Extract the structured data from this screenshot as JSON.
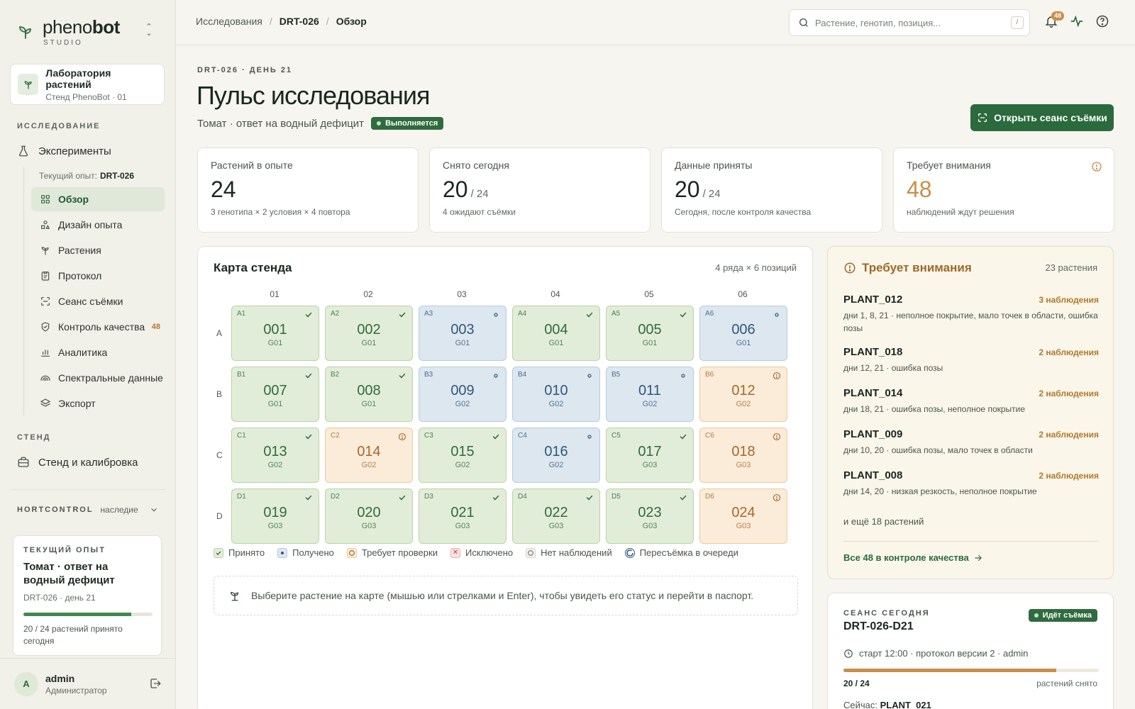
{
  "brand": {
    "name_light": "pheno",
    "name_bold": "bot",
    "sub": "STUDIO"
  },
  "lab": {
    "title": "Лаборатория растений",
    "subtitle": "Стенд PhenoBot · 01"
  },
  "sidebar": {
    "section_research": "ИССЛЕДОВАНИЕ",
    "experiments": "Эксперименты",
    "current_exp_label": "Текущий опыт:",
    "current_exp_id": "DRT-026",
    "items": [
      {
        "label": "Обзор",
        "icon": "grid-icon",
        "active": true
      },
      {
        "label": "Дизайн опыта",
        "icon": "shapes-icon"
      },
      {
        "label": "Растения",
        "icon": "sprout-icon"
      },
      {
        "label": "Протокол",
        "icon": "clipboard-icon"
      },
      {
        "label": "Сеанс съёмки",
        "icon": "scan-icon"
      },
      {
        "label": "Контроль качества",
        "icon": "shield-check-icon",
        "badge": "48"
      },
      {
        "label": "Аналитика",
        "icon": "bar-chart-icon"
      },
      {
        "label": "Спектральные данные",
        "icon": "rainbow-icon"
      },
      {
        "label": "Экспорт",
        "icon": "layers-icon"
      }
    ],
    "section_bench": "СТЕНД",
    "bench": "Стенд и калибровка",
    "legacy_key": "HORTCONTROL",
    "legacy_val": "наследие"
  },
  "current_card": {
    "label": "ТЕКУЩИЙ ОПЫТ",
    "title": "Томат · ответ на водный дефицит",
    "sub": "DRT-026 · день 21",
    "progress": 0.833,
    "foot": "20 / 24 растений принято сегодня"
  },
  "user": {
    "initial": "A",
    "name": "admin",
    "role": "Администратор"
  },
  "breadcrumbs": {
    "root": "Исследования",
    "mid": "DRT-026",
    "current": "Обзор"
  },
  "search": {
    "placeholder": "Растение, генотип, позиция...",
    "shortcut": "/"
  },
  "notifications": {
    "count": "48"
  },
  "header": {
    "eyebrow": "DRT-026 · ДЕНЬ 21",
    "title": "Пульс исследования",
    "subtitle": "Томат · ответ на водный дефицит",
    "status": "Выполняется",
    "action": "Открыть сеанс съёмки"
  },
  "kpis": [
    {
      "label": "Растений в опыте",
      "value": "24",
      "total": "",
      "foot": "3 генотипа × 2 условия × 4 повтора"
    },
    {
      "label": "Снято сегодня",
      "value": "20",
      "total": "/ 24",
      "foot": "4 ожидают съёмки"
    },
    {
      "label": "Данные приняты",
      "value": "20",
      "total": "/ 24",
      "foot": "Сегодня, после контроля качества"
    },
    {
      "label": "Требует внимания",
      "value": "48",
      "total": "",
      "foot": "наблюдений ждут решения"
    }
  ],
  "map": {
    "title": "Карта стенда",
    "meta": "4 ряда × 6 позиций",
    "columns": [
      "01",
      "02",
      "03",
      "04",
      "05",
      "06"
    ],
    "rows": [
      "A",
      "B",
      "C",
      "D"
    ],
    "cells": [
      [
        {
          "pos": "A1",
          "num": "001",
          "g": "G01",
          "s": "ok"
        },
        {
          "pos": "A2",
          "num": "002",
          "g": "G01",
          "s": "ok"
        },
        {
          "pos": "A3",
          "num": "003",
          "g": "G01",
          "s": "recv"
        },
        {
          "pos": "A4",
          "num": "004",
          "g": "G01",
          "s": "ok"
        },
        {
          "pos": "A5",
          "num": "005",
          "g": "G01",
          "s": "ok"
        },
        {
          "pos": "A6",
          "num": "006",
          "g": "G01",
          "s": "recv"
        }
      ],
      [
        {
          "pos": "B1",
          "num": "007",
          "g": "G01",
          "s": "ok"
        },
        {
          "pos": "B2",
          "num": "008",
          "g": "G01",
          "s": "ok"
        },
        {
          "pos": "B3",
          "num": "009",
          "g": "G02",
          "s": "recv"
        },
        {
          "pos": "B4",
          "num": "010",
          "g": "G02",
          "s": "recv"
        },
        {
          "pos": "B5",
          "num": "011",
          "g": "G02",
          "s": "recv"
        },
        {
          "pos": "B6",
          "num": "012",
          "g": "G02",
          "s": "warn"
        }
      ],
      [
        {
          "pos": "C1",
          "num": "013",
          "g": "G02",
          "s": "ok"
        },
        {
          "pos": "C2",
          "num": "014",
          "g": "G02",
          "s": "warn"
        },
        {
          "pos": "C3",
          "num": "015",
          "g": "G02",
          "s": "ok"
        },
        {
          "pos": "C4",
          "num": "016",
          "g": "G02",
          "s": "recv"
        },
        {
          "pos": "C5",
          "num": "017",
          "g": "G03",
          "s": "ok"
        },
        {
          "pos": "C6",
          "num": "018",
          "g": "G03",
          "s": "warn"
        }
      ],
      [
        {
          "pos": "D1",
          "num": "019",
          "g": "G03",
          "s": "ok"
        },
        {
          "pos": "D2",
          "num": "020",
          "g": "G03",
          "s": "ok"
        },
        {
          "pos": "D3",
          "num": "021",
          "g": "G03",
          "s": "ok"
        },
        {
          "pos": "D4",
          "num": "022",
          "g": "G03",
          "s": "ok"
        },
        {
          "pos": "D5",
          "num": "023",
          "g": "G03",
          "s": "ok"
        },
        {
          "pos": "D6",
          "num": "024",
          "g": "G03",
          "s": "warn"
        }
      ]
    ],
    "legend": [
      {
        "label": "Принято",
        "kind": "ok"
      },
      {
        "label": "Получено",
        "kind": "recv"
      },
      {
        "label": "Требует проверки",
        "kind": "warn"
      },
      {
        "label": "Исключено",
        "kind": "excl"
      },
      {
        "label": "Нет наблюдений",
        "kind": "none"
      },
      {
        "label": "Пересъёмка в очереди",
        "kind": "queue"
      }
    ],
    "hint": "Выберите растение на карте (мышью или стрелками и Enter), чтобы увидеть его статус и перейти в паспорт."
  },
  "attention": {
    "title": "Требует внимания",
    "meta": "23 растения",
    "items": [
      {
        "plant": "PLANT_012",
        "count": "3 наблюдения",
        "desc": "дни 1, 8, 21 · неполное покрытие, мало точек в области, ошибка позы"
      },
      {
        "plant": "PLANT_018",
        "count": "2 наблюдения",
        "desc": "дни 12, 21 · ошибка позы"
      },
      {
        "plant": "PLANT_014",
        "count": "2 наблюдения",
        "desc": "дни 18, 21 · ошибка позы, неполное покрытие"
      },
      {
        "plant": "PLANT_009",
        "count": "2 наблюдения",
        "desc": "дни 10, 20 · ошибка позы, мало точек в области"
      },
      {
        "plant": "PLANT_008",
        "count": "2 наблюдения",
        "desc": "дни 14, 20 · низкая резкость, неполное покрытие"
      }
    ],
    "more": "и ещё 18 растений",
    "link": "Все 48 в контроле качества"
  },
  "session": {
    "label": "СЕАНС СЕГОДНЯ",
    "title": "DRT-026-D21",
    "status": "Идёт съёмка",
    "meta": "старт 12:00 · протокол версии 2 · admin",
    "progress": 0.833,
    "count": "20 / 24",
    "count_label": "растений снято",
    "now_label": "Сейчас:",
    "now_value": "PLANT_021"
  },
  "colors": {
    "accent": "#2b6a3d",
    "warn": "#c98f48",
    "accepted_bg": "#e2edd9",
    "received_bg": "#dde7f0",
    "review_bg": "#faecd9"
  }
}
